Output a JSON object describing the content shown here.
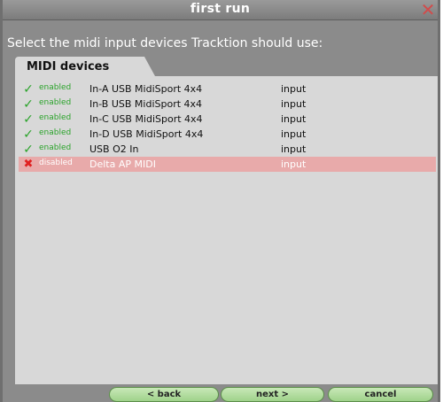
{
  "window": {
    "title": "first run"
  },
  "prompt": "Select the midi input devices Tracktion should use:",
  "tab": {
    "label": "MIDI devices"
  },
  "devices": [
    {
      "status": "enabled",
      "name": "In-A USB MidiSport 4x4",
      "type": "input"
    },
    {
      "status": "enabled",
      "name": "In-B USB MidiSport 4x4",
      "type": "input"
    },
    {
      "status": "enabled",
      "name": "In-C USB MidiSport 4x4",
      "type": "input"
    },
    {
      "status": "enabled",
      "name": "In-D USB MidiSport 4x4",
      "type": "input"
    },
    {
      "status": "enabled",
      "name": "USB O2 In",
      "type": "input"
    },
    {
      "status": "disabled",
      "name": "Delta AP MIDI",
      "type": "input"
    }
  ],
  "buttons": {
    "back": "< back",
    "next": "next >",
    "cancel": "cancel"
  },
  "icons": {
    "enabled": "checkmark-icon",
    "disabled": "cross-icon",
    "close": "close-icon"
  },
  "colors": {
    "enabled": "#2aa32a",
    "disabled_row": "#e8aaaa",
    "close": "#d14b4b",
    "button": "#9fd28a"
  }
}
